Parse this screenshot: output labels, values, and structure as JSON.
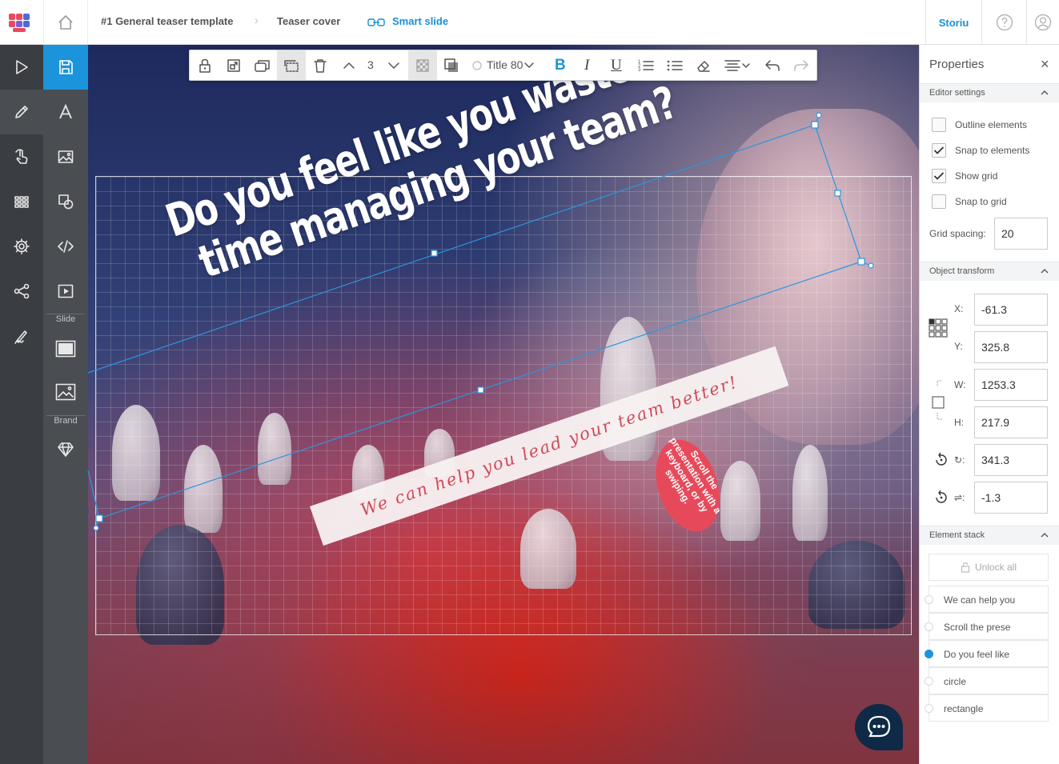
{
  "breadcrumb": {
    "project": "#1 General teaser template",
    "page": "Teaser cover",
    "slide": "Smart slide"
  },
  "brand": "Storiu",
  "colors": {
    "accent": "#1b94dc",
    "rail_dark": "#3a3d42",
    "rail_mid": "#4a4d52",
    "ribbon_text": "#d04a58",
    "blob": "#e64a5a"
  },
  "rail": {
    "icons": [
      "play-icon",
      "pencil-icon",
      "touch-icon",
      "grid-icon",
      "gear-icon",
      "share-icon",
      "signature-icon"
    ],
    "tools": [
      "save-icon",
      "text-icon",
      "image-icon",
      "shapes-icon",
      "code-icon",
      "video-icon"
    ],
    "slide_label": "Slide",
    "brand_label": "Brand"
  },
  "toolbar": {
    "layer_value": "3",
    "style_name": "Title 80",
    "bold": "B",
    "italic": "I",
    "underline": "U"
  },
  "slide": {
    "headline_line1": "Do you feel like you waste",
    "headline_line2": "time managing your team?",
    "ribbon": "We can help you lead your team better!",
    "bubble": "Scroll the presentation with a keyboard, or by swiping."
  },
  "properties": {
    "title": "Properties",
    "close": "×",
    "editor_settings": {
      "label": "Editor settings",
      "outline": "Outline elements",
      "snap_elements": "Snap to elements",
      "show_grid": "Show grid",
      "snap_grid": "Snap to grid",
      "outline_checked": false,
      "snap_elements_checked": true,
      "show_grid_checked": true,
      "snap_grid_checked": false,
      "grid_spacing_label": "Grid spacing:",
      "grid_spacing": "20"
    },
    "transform": {
      "label": "Object transform",
      "x_label": "X:",
      "x": "-61.3",
      "y_label": "Y:",
      "y": "325.8",
      "w_label": "W:",
      "w": "1253.3",
      "h_label": "H:",
      "h": "217.9",
      "rot_label": "↻:",
      "rot": "341.3",
      "skew_label": "⇌:",
      "skew": "-1.3"
    },
    "stack": {
      "label": "Element stack",
      "unlock": "Unlock all",
      "items": [
        "We can help you",
        "Scroll the prese",
        "Do you feel like",
        "circle",
        "rectangle"
      ],
      "selected_index": 2
    }
  }
}
